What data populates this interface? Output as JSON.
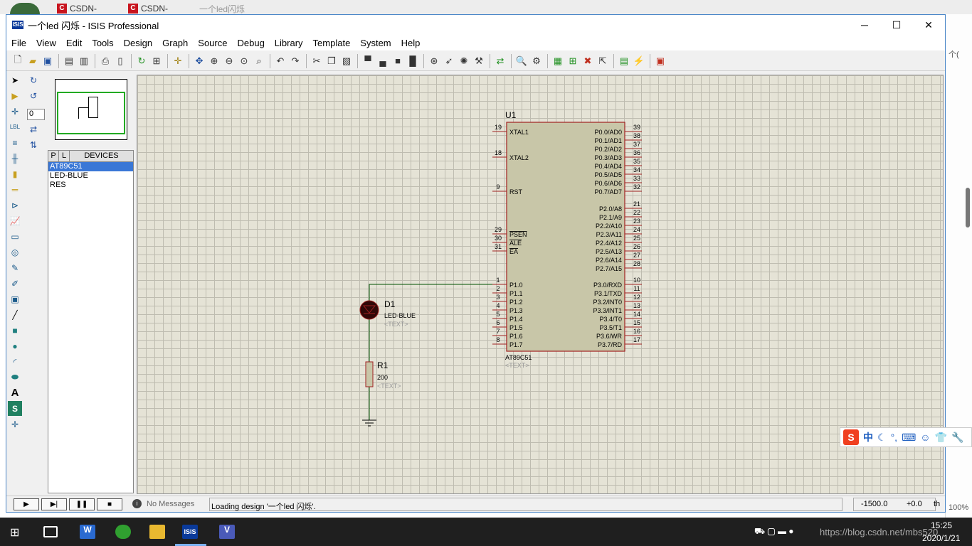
{
  "browser": {
    "tab1": "CSDN-",
    "tab2": "CSDN-",
    "tab3": "一个led闪烁"
  },
  "window": {
    "title": "一个led 闪烁 - ISIS Professional",
    "minimize": "─",
    "maximize": "☐",
    "close": "✕"
  },
  "menu": [
    "File",
    "View",
    "Edit",
    "Tools",
    "Design",
    "Graph",
    "Source",
    "Debug",
    "Library",
    "Template",
    "System",
    "Help"
  ],
  "left_toolbar": {
    "rotation_value": "0"
  },
  "devices": {
    "tab_p": "P",
    "tab_l": "L",
    "header": "DEVICES",
    "items": [
      "AT89C51",
      "LED-BLUE",
      "RES"
    ]
  },
  "schematic": {
    "u1_ref": "U1",
    "u1_value": "AT89C51",
    "u1_text": "<TEXT>",
    "left_pins": [
      {
        "num": "19",
        "name": "XTAL1"
      },
      {
        "num": "18",
        "name": "XTAL2"
      },
      {
        "num": "9",
        "name": "RST"
      },
      {
        "num": "29",
        "name": "PSEN"
      },
      {
        "num": "30",
        "name": "ALE"
      },
      {
        "num": "31",
        "name": "EA"
      },
      {
        "num": "1",
        "name": "P1.0"
      },
      {
        "num": "2",
        "name": "P1.1"
      },
      {
        "num": "3",
        "name": "P1.2"
      },
      {
        "num": "4",
        "name": "P1.3"
      },
      {
        "num": "5",
        "name": "P1.4"
      },
      {
        "num": "6",
        "name": "P1.5"
      },
      {
        "num": "7",
        "name": "P1.6"
      },
      {
        "num": "8",
        "name": "P1.7"
      }
    ],
    "right_pins": [
      {
        "num": "39",
        "name": "P0.0/AD0"
      },
      {
        "num": "38",
        "name": "P0.1/AD1"
      },
      {
        "num": "37",
        "name": "P0.2/AD2"
      },
      {
        "num": "36",
        "name": "P0.3/AD3"
      },
      {
        "num": "35",
        "name": "P0.4/AD4"
      },
      {
        "num": "34",
        "name": "P0.5/AD5"
      },
      {
        "num": "33",
        "name": "P0.6/AD6"
      },
      {
        "num": "32",
        "name": "P0.7/AD7"
      },
      {
        "num": "21",
        "name": "P2.0/A8"
      },
      {
        "num": "22",
        "name": "P2.1/A9"
      },
      {
        "num": "23",
        "name": "P2.2/A10"
      },
      {
        "num": "24",
        "name": "P2.3/A11"
      },
      {
        "num": "25",
        "name": "P2.4/A12"
      },
      {
        "num": "26",
        "name": "P2.5/A13"
      },
      {
        "num": "27",
        "name": "P2.6/A14"
      },
      {
        "num": "28",
        "name": "P2.7/A15"
      },
      {
        "num": "10",
        "name": "P3.0/RXD"
      },
      {
        "num": "11",
        "name": "P3.1/TXD"
      },
      {
        "num": "12",
        "name": "P3.2/INT0"
      },
      {
        "num": "13",
        "name": "P3.3/INT1"
      },
      {
        "num": "14",
        "name": "P3.4/T0"
      },
      {
        "num": "15",
        "name": "P3.5/T1"
      },
      {
        "num": "16",
        "name": "P3.6/WR"
      },
      {
        "num": "17",
        "name": "P3.7/RD"
      }
    ],
    "d1_ref": "D1",
    "d1_value": "LED-BLUE",
    "d1_text": "<TEXT>",
    "r1_ref": "R1",
    "r1_value": "200",
    "r1_text": "<TEXT>"
  },
  "status": {
    "messages": "No Messages",
    "loading": "Loading design '一个led 闪烁'.",
    "coord_x": "-1500.0",
    "coord_y": "+0.0",
    "unit": "th"
  },
  "taskbar": {
    "time": "15:25",
    "date": "2020/1/21",
    "watermark": "https://blog.csdn.net/mbs520",
    "ime": "中"
  },
  "right_edge": {
    "zoom": "100%",
    "text": "个("
  }
}
